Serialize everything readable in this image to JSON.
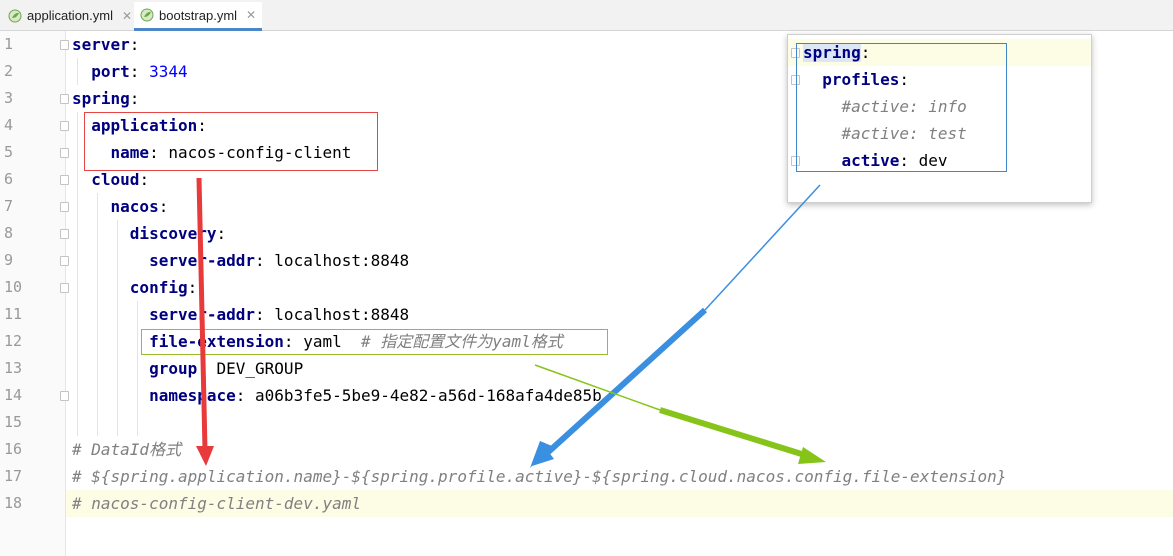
{
  "tabs": [
    {
      "label": "application.yml",
      "active": false
    },
    {
      "label": "bootstrap.yml",
      "active": true
    }
  ],
  "line_numbers": [
    "1",
    "2",
    "3",
    "4",
    "5",
    "6",
    "7",
    "8",
    "9",
    "10",
    "11",
    "12",
    "13",
    "14",
    "15",
    "16",
    "17",
    "18"
  ],
  "code": {
    "l1_key": "server",
    "l1_colon": ":",
    "l2_key": "port",
    "l2_colon": ": ",
    "l2_value": "3344",
    "l3_key": "spring",
    "l3_colon": ":",
    "l4_key": "application",
    "l4_colon": ":",
    "l5_key": "name",
    "l5_colon": ": ",
    "l5_value": "nacos-config-client",
    "l6_key": "cloud",
    "l6_colon": ":",
    "l7_key": "nacos",
    "l7_colon": ":",
    "l8_key": "discovery",
    "l8_colon": ":",
    "l9_key": "server-addr",
    "l9_colon": ": ",
    "l9_value": "localhost:8848",
    "l10_key": "config",
    "l10_colon": ":",
    "l11_key": "server-addr",
    "l11_colon": ": ",
    "l11_value": "localhost:8848",
    "l12_key": "file-extension",
    "l12_colon": ": ",
    "l12_value": "yaml  ",
    "l12_comment": "# 指定配置文件为yaml格式",
    "l13_key": "group",
    "l13_colon": ": ",
    "l13_value": "DEV_GROUP",
    "l14_key": "namespace",
    "l14_colon": ": ",
    "l14_value": "a06b3fe5-5be9-4e82-a56d-168afa4de85b",
    "l16_comment": "# DataId格式",
    "l17_comment": "# ${spring.application.name}-${spring.profile.active}-${spring.cloud.nacos.config.file-extension}",
    "l18_comment": "# nacos-config-client-dev.yaml"
  },
  "popup": {
    "p1_key": "spring",
    "p1_colon": ":",
    "p2_key": "profiles",
    "p2_colon": ":",
    "p3_comment": "#active: info",
    "p4_comment": "#active: test",
    "p5_key": "active",
    "p5_colon": ": ",
    "p5_value": "dev"
  },
  "colors": {
    "keyword": "#000080",
    "number": "#0000ff",
    "comment": "#808080",
    "red_arrow": "#e83a3a",
    "blue_arrow": "#3b8fe0",
    "green_arrow": "#86c41a"
  }
}
